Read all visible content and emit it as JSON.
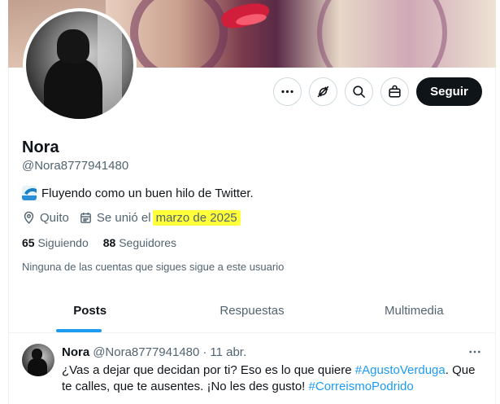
{
  "profile": {
    "name": "Nora",
    "handle": "@Nora8777941480",
    "bio": "Fluyendo como un buen hilo de Twitter.",
    "bio_icon": "wave-emoji",
    "location": "Quito",
    "joined_prefix": "Se unió el",
    "joined_date": "marzo de 2025",
    "following_count": "65",
    "following_label": "Siguiendo",
    "followers_count": "88",
    "followers_label": "Seguidores",
    "mutual_note": "Ninguna de las cuentas que sigues sigue a este usuario"
  },
  "actions": {
    "more_icon": "more-horizontal-icon",
    "grok_icon": "grok-icon",
    "search_icon": "search-icon",
    "subscribe_icon": "gift-bag-icon",
    "follow_label": "Seguir"
  },
  "tabs": [
    {
      "label": "Posts",
      "active": true
    },
    {
      "label": "Respuestas",
      "active": false
    },
    {
      "label": "Multimedia",
      "active": false
    }
  ],
  "tweet": {
    "name": "Nora",
    "handle": "@Nora8777941480",
    "dot": "·",
    "date": "11 abr.",
    "text_1": "¿Vas a dejar que decidan por ti? Eso es lo que quiere ",
    "hashtag_1": "#AgustoVerduga",
    "text_2": ". Que te calles, que te ausentes. ¡No les des gusto! ",
    "hashtag_2": "#CorreismoPodrido"
  },
  "colors": {
    "accent": "#1d9bf0",
    "highlight": "#ffff3a",
    "text_primary": "#0f1419",
    "text_secondary": "#536471"
  }
}
